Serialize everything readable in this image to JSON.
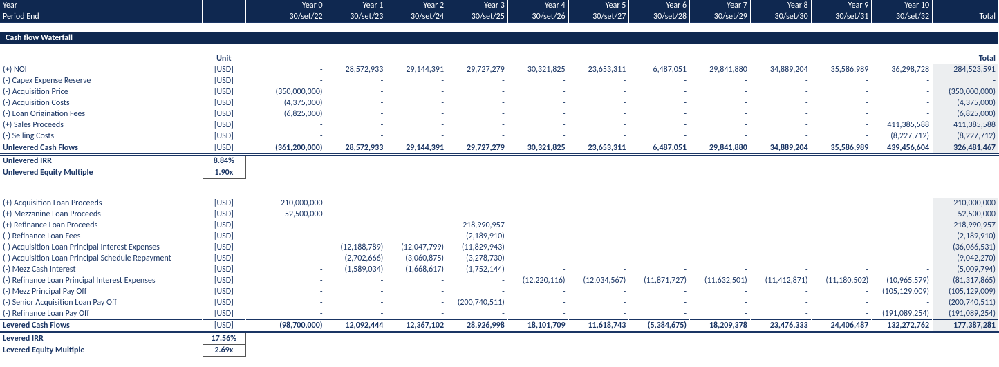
{
  "header": {
    "year_label": "Year",
    "period_end_label": "Period End",
    "years": [
      "Year 0",
      "Year 1",
      "Year 2",
      "Year 3",
      "Year 4",
      "Year 5",
      "Year 6",
      "Year 7",
      "Year 8",
      "Year 9",
      "Year 10"
    ],
    "dates": [
      "30/set/22",
      "30/set/23",
      "30/set/24",
      "30/set/25",
      "30/set/26",
      "30/set/27",
      "30/set/28",
      "30/set/29",
      "30/set/30",
      "30/set/31",
      "30/set/32"
    ],
    "total": "Total"
  },
  "section_title": "Cash flow Waterfall",
  "unit_header": "Unit",
  "total_header": "Total",
  "rows": [
    {
      "label": "(+) NOI",
      "unit": "[USD]",
      "cells": [
        "-",
        "28,572,933",
        "29,144,391",
        "29,727,279",
        "30,321,825",
        "23,653,311",
        "6,487,051",
        "29,841,880",
        "34,889,204",
        "35,586,989",
        "36,298,728"
      ],
      "total": "284,523,591"
    },
    {
      "label": "(-) Capex Expense Reserve",
      "unit": "[USD]",
      "cells": [
        "-",
        "-",
        "-",
        "-",
        "-",
        "-",
        "-",
        "-",
        "-",
        "-",
        "-"
      ],
      "total": "-"
    },
    {
      "label": "(-) Acquisition Price",
      "unit": "[USD]",
      "cells": [
        "(350,000,000)",
        "-",
        "-",
        "-",
        "-",
        "-",
        "-",
        "-",
        "-",
        "-",
        "-"
      ],
      "total": "(350,000,000)"
    },
    {
      "label": "(-) Acquisition Costs",
      "unit": "[USD]",
      "cells": [
        "(4,375,000)",
        "-",
        "-",
        "-",
        "-",
        "-",
        "-",
        "-",
        "-",
        "-",
        "-"
      ],
      "total": "(4,375,000)"
    },
    {
      "label": "(-) Loan Origination Fees",
      "unit": "[USD]",
      "cells": [
        "(6,825,000)",
        "-",
        "-",
        "-",
        "-",
        "-",
        "-",
        "-",
        "-",
        "-",
        "-"
      ],
      "total": "(6,825,000)"
    },
    {
      "label": "(+) Sales Proceeds",
      "unit": "[USD]",
      "cells": [
        "-",
        "-",
        "-",
        "-",
        "-",
        "-",
        "-",
        "-",
        "-",
        "-",
        "411,385,588"
      ],
      "total": "411,385,588"
    },
    {
      "label": "(-) Selling Costs",
      "unit": "[USD]",
      "cells": [
        "-",
        "-",
        "-",
        "-",
        "-",
        "-",
        "-",
        "-",
        "-",
        "-",
        "(8,227,712)"
      ],
      "total": "(8,227,712)"
    }
  ],
  "unlevered_row": {
    "label": "Unlevered Cash Flows",
    "unit": "[USD]",
    "cells": [
      "(361,200,000)",
      "28,572,933",
      "29,144,391",
      "29,727,279",
      "30,321,825",
      "23,653,311",
      "6,487,051",
      "29,841,880",
      "34,889,204",
      "35,586,989",
      "439,456,604"
    ],
    "total": "326,481,467"
  },
  "unlevered_irr": {
    "label": "Unlevered IRR",
    "value": "8.84%"
  },
  "unlevered_mult": {
    "label": "Unlevered Equity Multiple",
    "value": "1.90x"
  },
  "rows2": [
    {
      "label": "(+) Acquisition Loan Proceeds",
      "unit": "[USD]",
      "cells": [
        "210,000,000",
        "-",
        "-",
        "-",
        "-",
        "-",
        "-",
        "-",
        "-",
        "-",
        "-"
      ],
      "total": "210,000,000"
    },
    {
      "label": "(+) Mezzanine Loan Proceeds",
      "unit": "[USD]",
      "cells": [
        "52,500,000",
        "-",
        "-",
        "-",
        "-",
        "-",
        "-",
        "-",
        "-",
        "-",
        "-"
      ],
      "total": "52,500,000"
    },
    {
      "label": "(+) Refinance Loan Proceeds",
      "unit": "[USD]",
      "cells": [
        "-",
        "-",
        "-",
        "218,990,957",
        "-",
        "-",
        "-",
        "-",
        "-",
        "-",
        "-"
      ],
      "total": "218,990,957"
    },
    {
      "label": "(-) Refinance Loan Fees",
      "unit": "[USD]",
      "cells": [
        "-",
        "-",
        "-",
        "(2,189,910)",
        "-",
        "-",
        "-",
        "-",
        "-",
        "-",
        "-"
      ],
      "total": "(2,189,910)"
    },
    {
      "label": "(-) Acquisition Loan Principal Interest Expenses",
      "unit": "[USD]",
      "cells": [
        "-",
        "(12,188,789)",
        "(12,047,799)",
        "(11,829,943)",
        "-",
        "-",
        "-",
        "-",
        "-",
        "-",
        "-"
      ],
      "total": "(36,066,531)"
    },
    {
      "label": "(-) Acquisition Loan Principal Schedule Repayment",
      "unit": "[USD]",
      "cells": [
        "-",
        "(2,702,666)",
        "(3,060,875)",
        "(3,278,730)",
        "-",
        "-",
        "-",
        "-",
        "-",
        "-",
        "-"
      ],
      "total": "(9,042,270)"
    },
    {
      "label": "(-) Mezz Cash Interest",
      "unit": "[USD]",
      "cells": [
        "-",
        "(1,589,034)",
        "(1,668,617)",
        "(1,752,144)",
        "-",
        "-",
        "-",
        "-",
        "-",
        "-",
        "-"
      ],
      "total": "(5,009,794)"
    },
    {
      "label": "(-) Refinance Loan Principal Interest Expenses",
      "unit": "[USD]",
      "cells": [
        "-",
        "-",
        "-",
        "-",
        "(12,220,116)",
        "(12,034,567)",
        "(11,871,727)",
        "(11,632,501)",
        "(11,412,871)",
        "(11,180,502)",
        "(10,965,579)"
      ],
      "total": "(81,317,865)"
    },
    {
      "label": "(-) Mezz Principal Pay Off",
      "unit": "[USD]",
      "cells": [
        "-",
        "-",
        "-",
        "-",
        "-",
        "-",
        "-",
        "-",
        "-",
        "-",
        "(105,129,009)"
      ],
      "total": "(105,129,009)"
    },
    {
      "label": "(-) Senior Acquisition Loan Pay Off",
      "unit": "[USD]",
      "cells": [
        "-",
        "-",
        "-",
        "(200,740,511)",
        "-",
        "-",
        "-",
        "-",
        "-",
        "-",
        "-"
      ],
      "total": "(200,740,511)"
    },
    {
      "label": "(-) Refinance Loan Pay Off",
      "unit": "[USD]",
      "cells": [
        "-",
        "-",
        "-",
        "-",
        "-",
        "-",
        "-",
        "-",
        "-",
        "-",
        "(191,089,254)"
      ],
      "total": "(191,089,254)"
    }
  ],
  "levered_row": {
    "label": "Levered Cash Flows",
    "unit": "[USD]",
    "cells": [
      "(98,700,000)",
      "12,092,444",
      "12,367,102",
      "28,926,998",
      "18,101,709",
      "11,618,743",
      "(5,384,675)",
      "18,209,378",
      "23,476,333",
      "24,406,487",
      "132,272,762"
    ],
    "total": "177,387,281"
  },
  "levered_irr": {
    "label": "Levered IRR",
    "value": "17.56%"
  },
  "levered_mult": {
    "label": "Levered Equity Multiple",
    "value": "2.69x"
  }
}
